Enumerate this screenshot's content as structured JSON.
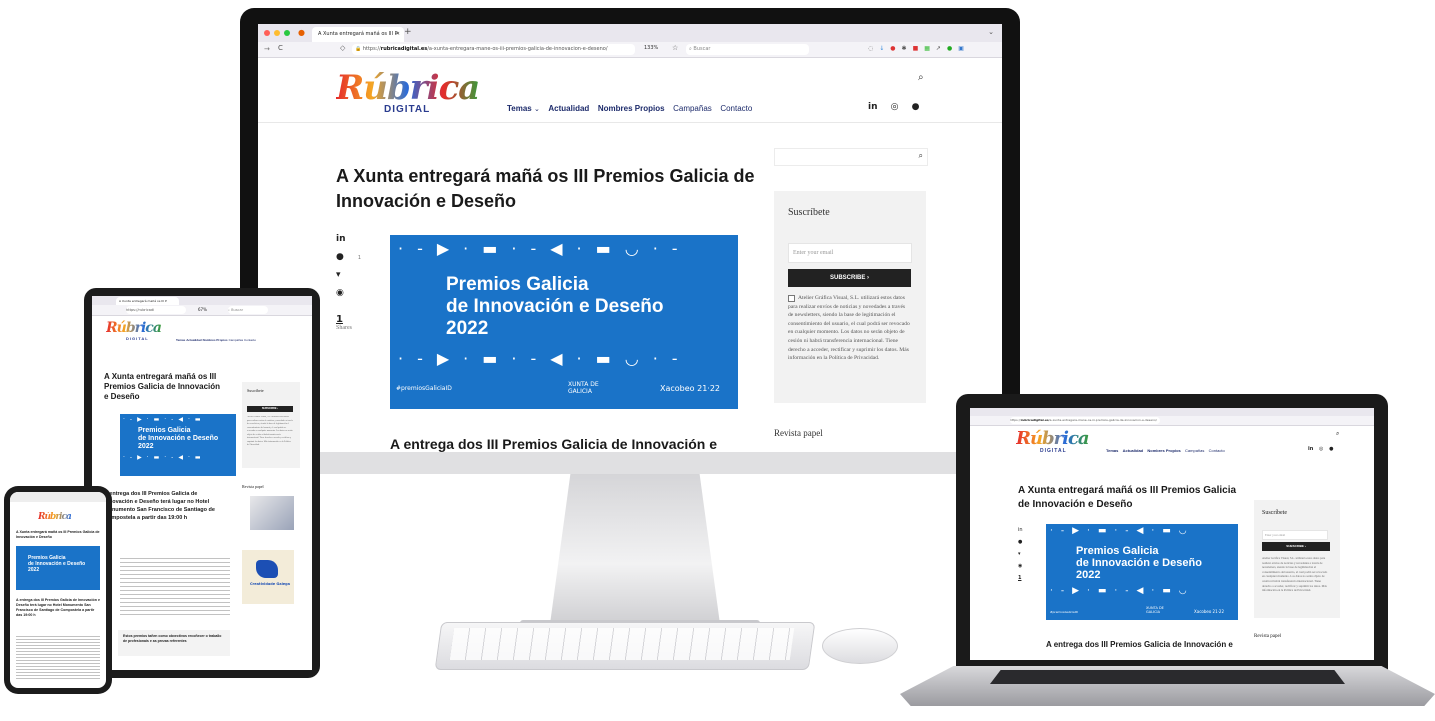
{
  "browser": {
    "tab_title": "A Xunta entregará mañá os III P",
    "url_host": "rubricadigital.es",
    "url_scheme": "https://",
    "url_path": "/a-xunta-entregara-mane-os-iii-premios-galicia-de-innovacion-e-deseno/",
    "zoom": "133%",
    "search_placeholder": "Buscar",
    "tablet_zoom": "67%",
    "tablet_url": "https://rubricadi"
  },
  "site": {
    "logo_text": "Rúbrica",
    "logo_sub": "DIGITAL",
    "nav": [
      "Temas",
      "Actualidad",
      "Nombres Propios",
      "Campañas",
      "Contacto"
    ],
    "social": [
      "in",
      "◎",
      "●"
    ]
  },
  "article": {
    "title": "A Xunta entregará mañá os III Premios Galicia de Innovación e Deseño",
    "share_count": "1",
    "share_label": "Shares",
    "subheading": "A entrega dos III Premios Galicia de Innovación e",
    "subheading_full": "A entrega dos III Premios Galicia de Innovación e Deseño terá lugar no Hotel Monumento San Francisco de Santiago de Compostela a partir das 19:00 h",
    "callout": "Estos premios tañen como obxectivos recoñecer o traballo de profesionais e as prezas referentes"
  },
  "banner": {
    "line1": "Premios Galicia",
    "line2": "de Innovación e Deseño",
    "line3": "2022",
    "hashtag": "#premiosGaliciaID",
    "xunta": "XUNTA DE GALICIA",
    "xacobeo": "Xacobeo 21·22"
  },
  "sidebar": {
    "subscribe_title": "Suscríbete",
    "email_placeholder": "Enter your email",
    "subscribe_button": "SUBSCRIBE ›",
    "consent": "Atelier Gráfica Visual, S.L. utilizará estos datos para realizar envíos de noticias y novedades a través de newsletters, siendo la base de legitimación el consentimiento del usuario, el cual podrá ser revocado en cualquier momento. Los datos no serán objeto de cesión ni habrá transferencia internacional. Tiene derecho a acceder, rectificar y suprimir los datos. Más información en la Política de Privacidad.",
    "revista": "Revista papel",
    "creatividade": "Creatividade Galega"
  },
  "colors": {
    "banner_blue": "#1a73c8",
    "nav_blue": "#1d2b6b",
    "dark": "#111111"
  }
}
